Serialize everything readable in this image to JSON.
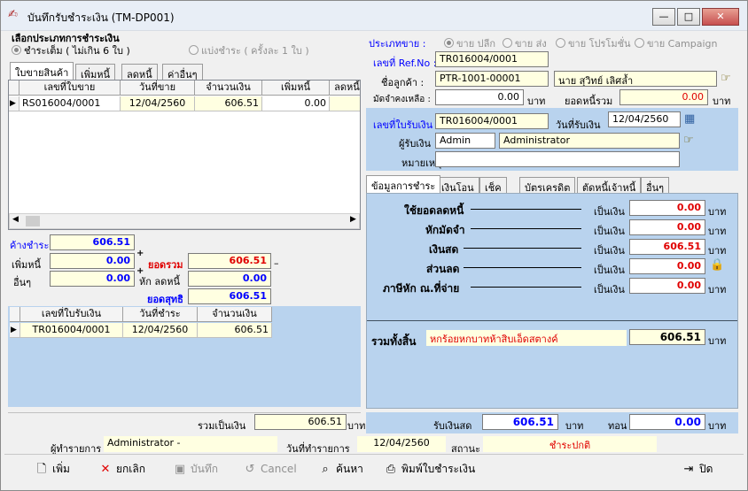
{
  "window": {
    "title": "บันทึกรับชำระเงิน (TM-DP001)",
    "min": "—",
    "max": "□",
    "close": "✕"
  },
  "pay_type": {
    "label": "เลือกประเภทการชำระเงิน",
    "opt_full": "ชำระเต็ม ( ไม่เกิน 6 ใบ )",
    "opt_split": "แบ่งชำระ ( ครั้งละ 1 ใบ )"
  },
  "sale_type": {
    "label": "ประเภทขาย :",
    "opts": [
      "ขาย ปลีก",
      "ขาย ส่ง",
      "ขาย โปรโมชั่น",
      "ขาย Campaign"
    ]
  },
  "ref": {
    "label": "เลขที่ Ref.No :",
    "value": "TR016004/0001"
  },
  "customer": {
    "label": "ชื่อลูกค้า :",
    "code": "PTR-1001-00001",
    "name": "นาย สุวิทย์ เลิศล้ำ"
  },
  "credit": {
    "label": "มัดจำคงเหลือ :",
    "value": "0.00",
    "unit": "บาท",
    "debt_label": "ยอดหนี้รวม",
    "debt_value": "0.00",
    "debt_unit": "บาท"
  },
  "left_tabs": [
    "ใบขายสินค้า",
    "เพิ่มหนี้",
    "ลดหนี้",
    "ค่าอื่นๆ"
  ],
  "invoice_grid": {
    "headers": [
      "เลขที่ใบขาย",
      "วันที่ขาย",
      "จำนวนเงิน",
      "เพิ่มหนี้",
      "ลดหนี้"
    ],
    "rows": [
      [
        "RS016004/0001",
        "12/04/2560",
        "606.51",
        "0.00",
        ""
      ]
    ]
  },
  "summary": {
    "outstanding_label": "ค้างชำระ",
    "outstanding": "606.51",
    "add_debt_label": "เพิ่มหนี้",
    "add_debt": "0.00",
    "other_label": "อื่นๆ",
    "other": "0.00",
    "total_label": "ยอดรวม",
    "total": "606.51",
    "deduct_label": "หัก ลดหนี้",
    "deduct": "0.00",
    "net_label": "ยอดสุทธิ",
    "net": "606.51"
  },
  "receipt_grid": {
    "headers": [
      "เลขที่ใบรับเงิน",
      "วันที่ชำระ",
      "จำนวนเงิน"
    ],
    "rows": [
      [
        "TR016004/0001",
        "12/04/2560",
        "606.51"
      ]
    ]
  },
  "receipt": {
    "no_label": "เลขที่ใบรับเงิน",
    "no": "TR016004/0001",
    "date_label": "วันที่รับเงิน",
    "date": "12/04/2560",
    "recv_label": "ผู้รับเงิน",
    "recv_code": "Admin",
    "recv_name": "Administrator",
    "note_label": "หมายเหตุ",
    "note": ""
  },
  "pay_tabs": [
    "ข้อมูลการชำระ",
    "เงินโอน",
    "เช็ค",
    "บัตรเครดิต",
    "ตัดหนี้เจ้าหนี้",
    "อื่นๆ"
  ],
  "pay_rows": [
    {
      "label": "ใช้ยอดลดหนี้",
      "as": "เป็นเงิน",
      "value": "0.00",
      "unit": "บาท"
    },
    {
      "label": "หักมัดจำ",
      "as": "เป็นเงิน",
      "value": "0.00",
      "unit": "บาท"
    },
    {
      "label": "เงินสด",
      "as": "เป็นเงิน",
      "value": "606.51",
      "unit": "บาท"
    },
    {
      "label": "ส่วนลด",
      "as": "เป็นเงิน",
      "value": "0.00",
      "unit": "บาท"
    },
    {
      "label": "ภาษีหัก ณ.ที่จ่าย",
      "as": "เป็นเงิน",
      "value": "0.00",
      "unit": "บาท"
    }
  ],
  "grand_total": {
    "label": "รวมทั้งสิ้น",
    "words": "หกร้อยหกบาทห้าสิบเอ็ดสตางค์",
    "value": "606.51",
    "unit": "บาท"
  },
  "footer": {
    "sum_label": "รวมเป็นเงิน",
    "sum": "606.51",
    "sum_unit": "บาท",
    "cash_label": "รับเงินสด",
    "cash": "606.51",
    "cash_unit": "บาท",
    "change_label": "ทอน",
    "change": "0.00",
    "change_unit": "บาท"
  },
  "status": {
    "user_label": "ผู้ทำรายการ",
    "user": "Administrator -",
    "date_label": "วันที่ทำรายการ",
    "date": "12/04/2560",
    "state_label": "สถานะ",
    "state": "ชำระปกติ"
  },
  "toolbar": {
    "add": "เพิ่ม",
    "cancel_doc": "ยกเลิก",
    "save": "บันทึก",
    "cancel": "Cancel",
    "search": "ค้นหา",
    "print": "พิมพ์ใบชำระเงิน",
    "close": "ปิด"
  }
}
